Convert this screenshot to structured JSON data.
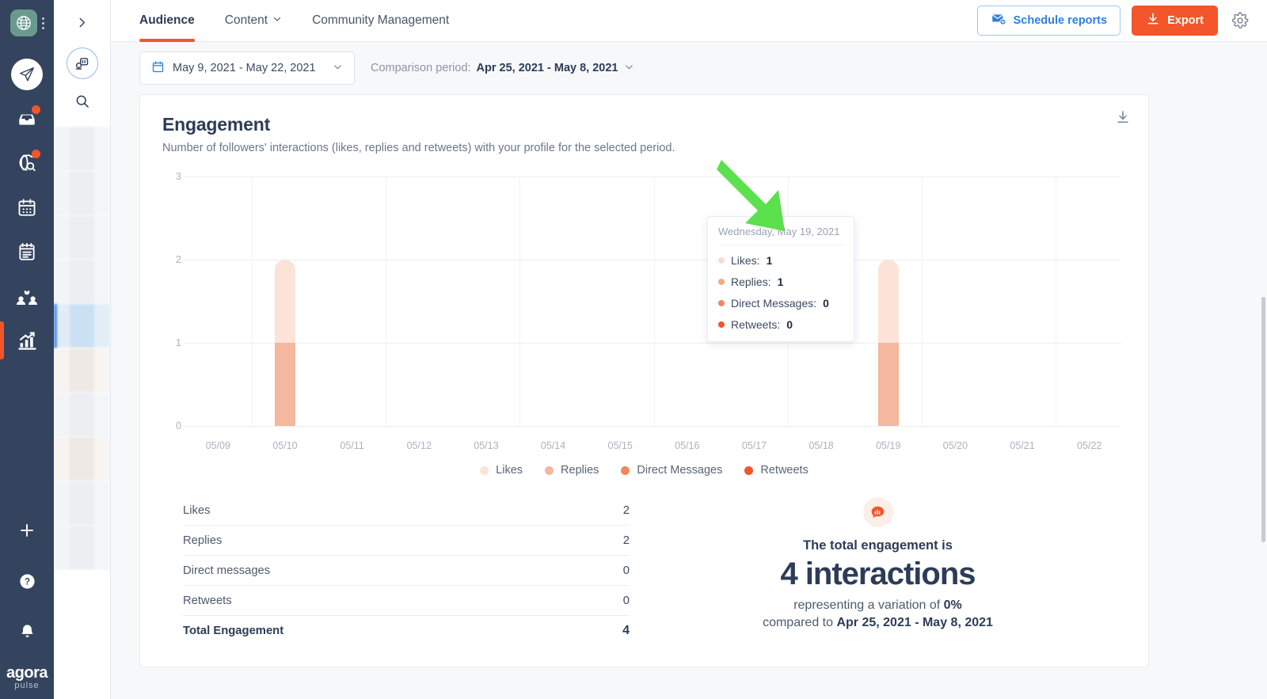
{
  "app": {
    "logo_primary": "agora",
    "logo_secondary": "pulse"
  },
  "sidebar": {
    "items": [
      {
        "name": "profile-avatar",
        "icon": "globe-network-icon",
        "label": "Profile"
      },
      {
        "name": "publish",
        "icon": "paper-plane-icon",
        "label": "Publish"
      },
      {
        "name": "inbox",
        "icon": "inbox-tray-icon",
        "label": "Inbox",
        "badge": true
      },
      {
        "name": "listening",
        "icon": "globe-search-icon",
        "label": "Listening",
        "badge": true
      },
      {
        "name": "calendar",
        "icon": "calendar-icon",
        "label": "Calendar"
      },
      {
        "name": "reports",
        "icon": "notepad-icon",
        "label": "Reports"
      },
      {
        "name": "fans",
        "icon": "users-group-icon",
        "label": "Fans"
      },
      {
        "name": "analytics",
        "icon": "bar-chart-growth-icon",
        "label": "Analytics",
        "active": true
      }
    ],
    "bottom_items": [
      {
        "name": "add",
        "icon": "plus-icon",
        "label": "Add"
      },
      {
        "name": "help",
        "icon": "question-circle-icon",
        "label": "Help"
      },
      {
        "name": "notifications",
        "icon": "bell-icon",
        "label": "Notifications"
      }
    ]
  },
  "profile_panel": {
    "expand_icon": "chevron-right-icon",
    "add_profile_icon": "add-profile-icon",
    "search_icon": "search-icon"
  },
  "topbar": {
    "tabs": [
      {
        "label": "Audience",
        "active": true,
        "caret": false
      },
      {
        "label": "Content",
        "active": false,
        "caret": true
      },
      {
        "label": "Community Management",
        "active": false,
        "caret": false
      }
    ],
    "schedule_reports_label": "Schedule reports",
    "schedule_reports_icon": "envelope-add-icon",
    "export_label": "Export",
    "export_icon": "download-icon",
    "settings_icon": "gear-icon"
  },
  "filterbar": {
    "date_range": "May 9, 2021 - May 22, 2021",
    "calendar_icon": "calendar-icon",
    "caret_icon": "chevron-down-icon",
    "comparison_prefix": "Comparison period:",
    "comparison_value": "Apr 25, 2021 - May 8, 2021"
  },
  "card": {
    "title": "Engagement",
    "subtitle": "Number of followers' interactions (likes, replies and retweets) with your profile for the selected period.",
    "download_icon": "download-icon"
  },
  "tooltip": {
    "date": "Wednesday, May 19, 2021",
    "rows": [
      {
        "label": "Likes:",
        "value": "1",
        "color": "#fbdbce"
      },
      {
        "label": "Replies:",
        "value": "1",
        "color": "#f4a886"
      },
      {
        "label": "Direct Messages:",
        "value": "0",
        "color": "#f0875c"
      },
      {
        "label": "Retweets:",
        "value": "0",
        "color": "#f2562a"
      }
    ]
  },
  "annotation": {
    "arrow_color": "#5be04e",
    "arrow_icon": "arrow-pointer-icon"
  },
  "stats": {
    "rows": [
      {
        "label": "Likes",
        "value": "2"
      },
      {
        "label": "Replies",
        "value": "2"
      },
      {
        "label": "Direct messages",
        "value": "0"
      },
      {
        "label": "Retweets",
        "value": "0"
      }
    ],
    "total_label": "Total Engagement",
    "total_value": "4"
  },
  "summary": {
    "icon": "chat-chart-icon",
    "line1": "The total engagement is",
    "big": "4 interactions",
    "line3_prefix": "representing a variation of ",
    "line3_value": "0%",
    "line4_prefix": "compared to ",
    "line4_value": "Apr 25, 2021 - May 8, 2021"
  },
  "chart_data": {
    "type": "bar",
    "stacked": true,
    "title": "Engagement",
    "subtitle": "Number of followers' interactions (likes, replies and retweets) with your profile for the selected period.",
    "xlabel": "",
    "ylabel": "",
    "ylim": [
      0,
      3
    ],
    "yticks": [
      0,
      1,
      2,
      3
    ],
    "grid": true,
    "legend_position": "bottom",
    "categories": [
      "05/09",
      "05/10",
      "05/11",
      "05/12",
      "05/13",
      "05/14",
      "05/15",
      "05/16",
      "05/17",
      "05/18",
      "05/19",
      "05/20",
      "05/21",
      "05/22"
    ],
    "series": [
      {
        "name": "Likes",
        "color": "#fce3d8",
        "values": [
          0,
          1,
          0,
          0,
          0,
          0,
          0,
          0,
          0,
          0,
          1,
          0,
          0,
          0
        ]
      },
      {
        "name": "Replies",
        "color": "#f5b79d",
        "values": [
          0,
          1,
          0,
          0,
          0,
          0,
          0,
          0,
          0,
          0,
          1,
          0,
          0,
          0
        ]
      },
      {
        "name": "Direct Messages",
        "color": "#f0875c",
        "values": [
          0,
          0,
          0,
          0,
          0,
          0,
          0,
          0,
          0,
          0,
          0,
          0,
          0,
          0
        ]
      },
      {
        "name": "Retweets",
        "color": "#f2562a",
        "values": [
          0,
          0,
          0,
          0,
          0,
          0,
          0,
          0,
          0,
          0,
          0,
          0,
          0,
          0
        ]
      }
    ],
    "totals": [
      0,
      2,
      0,
      0,
      0,
      0,
      0,
      0,
      0,
      0,
      2,
      0,
      0,
      0
    ]
  }
}
